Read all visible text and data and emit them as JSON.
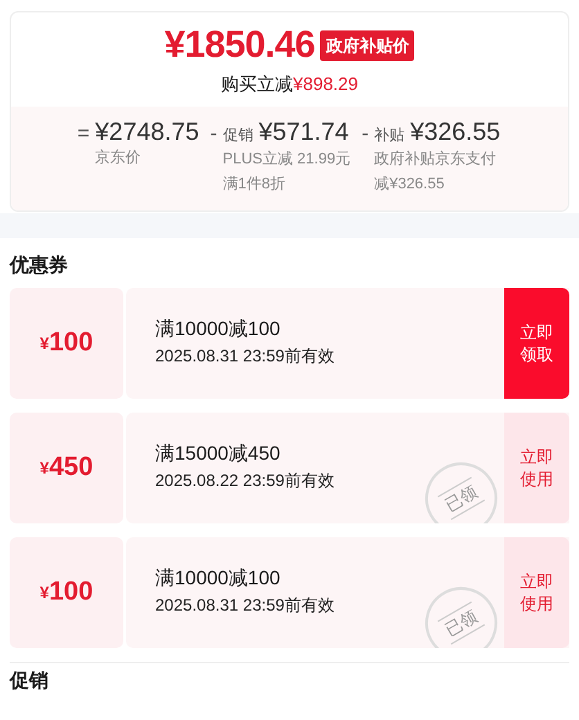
{
  "price_card": {
    "price": "¥1850.46",
    "price_tag": "政府补贴价",
    "saving_label": "购买立减",
    "saving_amount": "¥898.29",
    "breakdown": [
      {
        "operator": "=",
        "amount": "¥2748.75",
        "notes": [
          "京东价"
        ]
      },
      {
        "operator": "-",
        "label": "促销",
        "amount": "¥571.74",
        "notes": [
          "PLUS立减 21.99元",
          "满1件8折"
        ]
      },
      {
        "operator": "-",
        "label": "补贴",
        "amount": "¥326.55",
        "notes": [
          "政府补贴京东支付减¥326.55"
        ]
      }
    ]
  },
  "coupons_section": {
    "title": "优惠券",
    "coupons": [
      {
        "currency": "¥",
        "value": "100",
        "condition": "满10000减100",
        "validity": "2025.08.31 23:59前有效",
        "action": "立即领取",
        "claimed": false
      },
      {
        "currency": "¥",
        "value": "450",
        "condition": "满15000减450",
        "validity": "2025.08.22 23:59前有效",
        "action": "立即使用",
        "claimed": true,
        "stamp": "已领"
      },
      {
        "currency": "¥",
        "value": "100",
        "condition": "满10000减100",
        "validity": "2025.08.31 23:59前有效",
        "action": "立即使用",
        "claimed": true,
        "stamp": "已领"
      }
    ]
  },
  "promotions_section": {
    "title": "促销"
  }
}
